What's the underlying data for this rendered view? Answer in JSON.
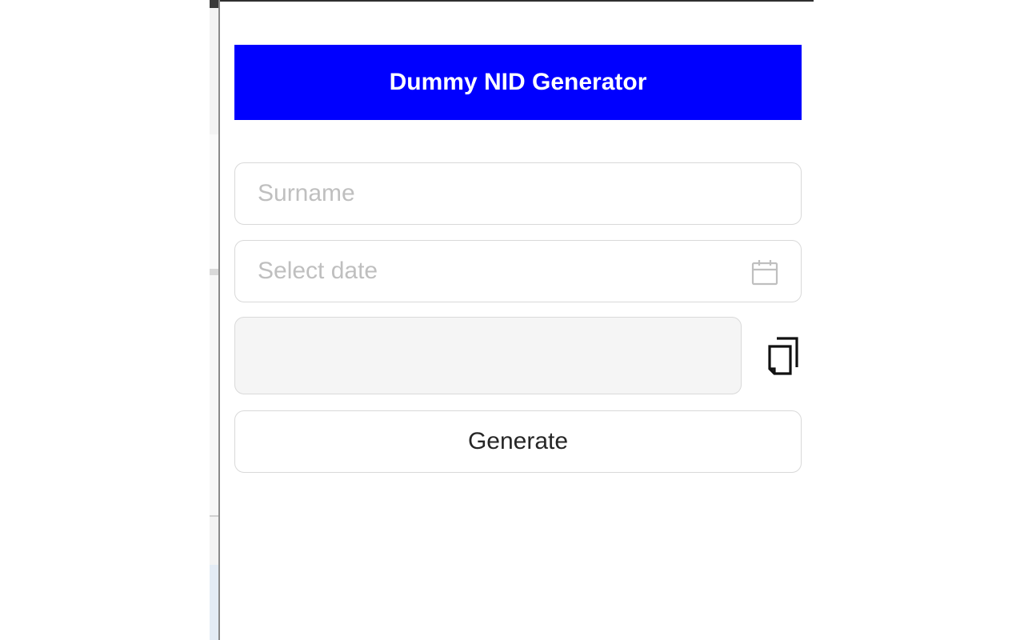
{
  "header": {
    "title": "Dummy NID Generator",
    "background_color": "#0000ff"
  },
  "form": {
    "surname": {
      "placeholder": "Surname",
      "value": ""
    },
    "date": {
      "placeholder": "Select date",
      "value": "",
      "icon": "calendar-icon"
    },
    "output": {
      "value": "",
      "copy_icon": "copy-icon"
    },
    "generate_label": "Generate"
  }
}
